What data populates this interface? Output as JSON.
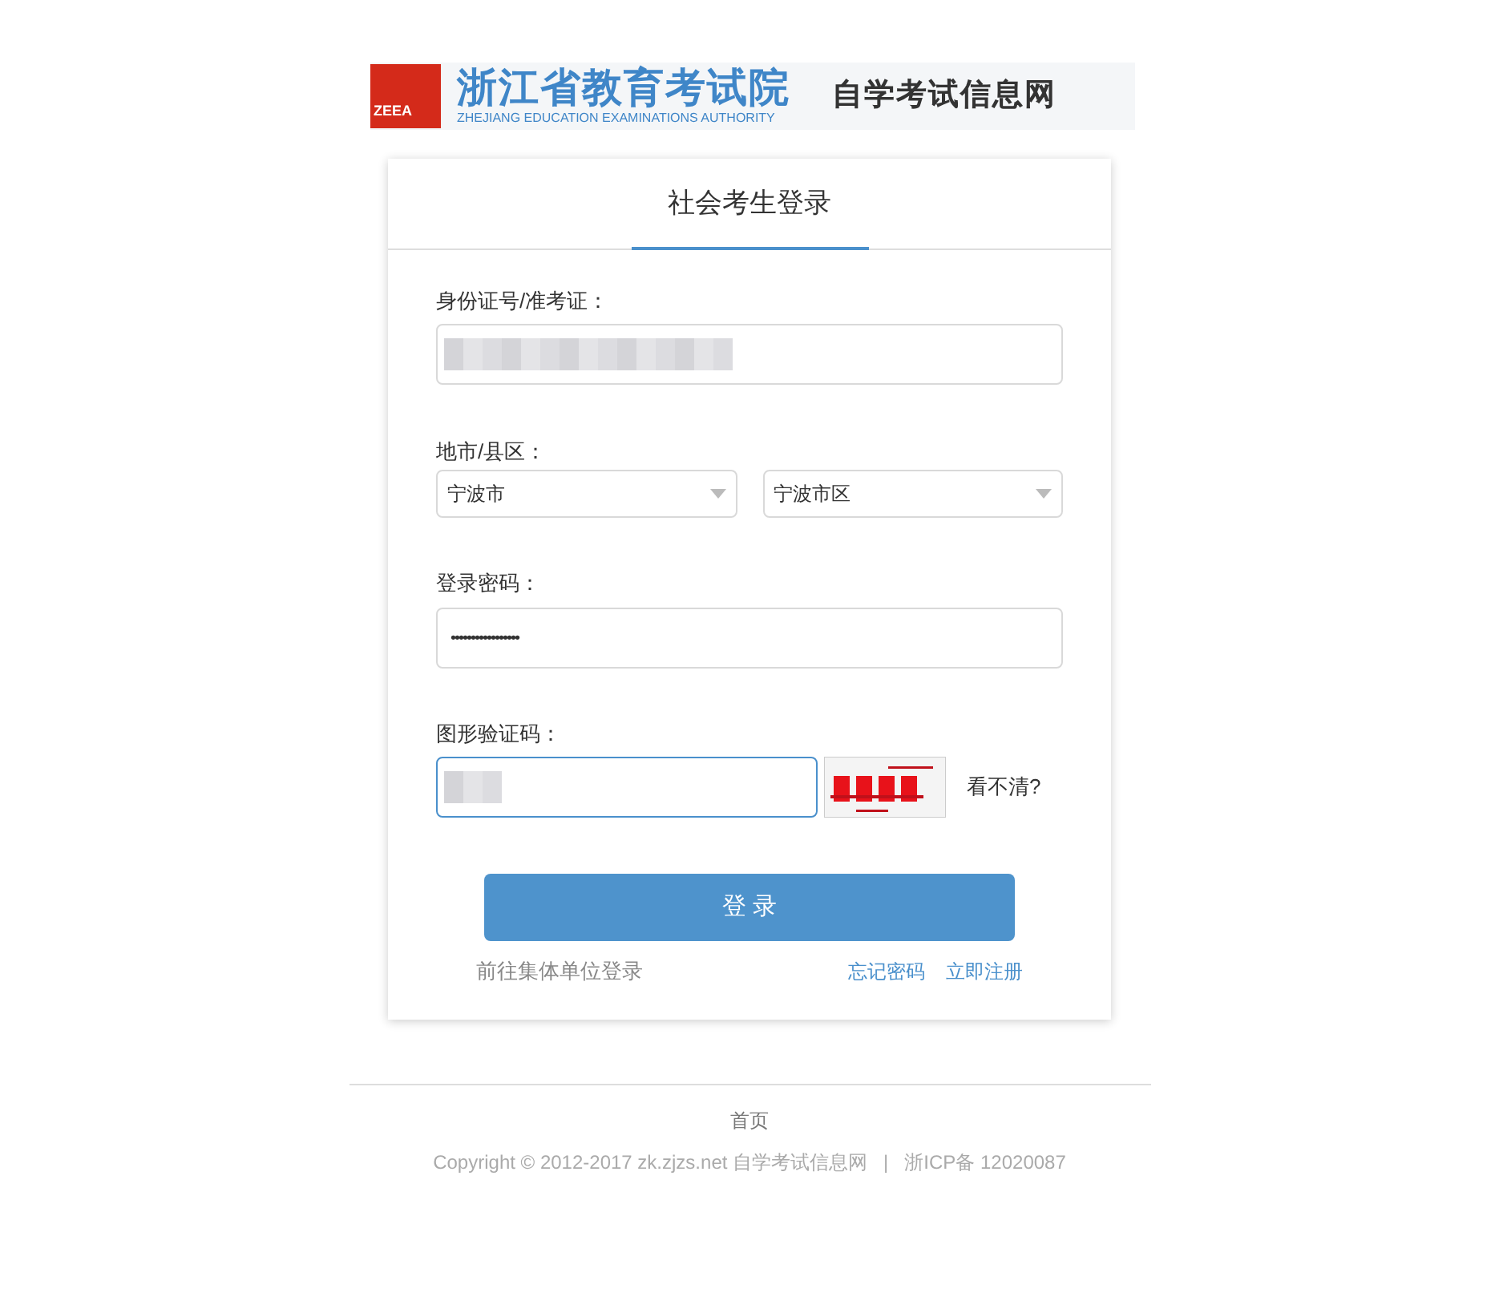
{
  "header": {
    "logo_mark": "ZEEA",
    "title": "浙江省教育考试院",
    "subtitle": "ZHEJIANG EDUCATION EXAMINATIONS AUTHORITY",
    "site_name": "自学考试信息网"
  },
  "tabs": [
    {
      "label": "社会考生登录",
      "selected": true
    }
  ],
  "form": {
    "id_label": "身份证号/准考证：",
    "region_label": "地市/县区：",
    "selects": [
      {
        "value": "宁波市"
      },
      {
        "value": "宁波市区"
      }
    ],
    "password_label": "登录密码：",
    "password_value": "•••••••••••••••••",
    "captcha_label": "图形验证码：",
    "captcha_refresh": "看不清?",
    "submit": "登 录",
    "group_login": "前往集体单位登录",
    "links": [
      "忘记密码",
      "立即注册"
    ]
  },
  "footer": {
    "home": "首页",
    "copyright": "Copyright © 2012-2017 zk.zjzs.net 自学考试信息网",
    "separator": "|",
    "icp": "浙ICP备 12020087"
  }
}
